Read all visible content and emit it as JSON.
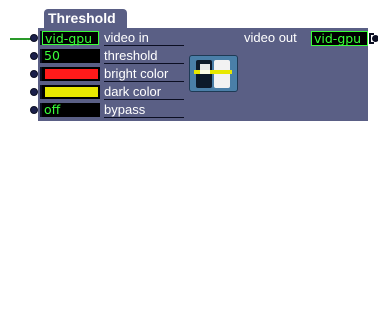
{
  "actor": {
    "title": "Threshold",
    "inputs": [
      {
        "value": "vid-gpu",
        "label": "video in",
        "kind": "video",
        "connected": true
      },
      {
        "value": "50",
        "label": "threshold",
        "kind": "number"
      },
      {
        "value": "",
        "label": "bright color",
        "kind": "color",
        "color": "#ff1a1a"
      },
      {
        "value": "",
        "label": "dark color",
        "kind": "color",
        "color": "#e8e800"
      },
      {
        "value": "off",
        "label": "bypass",
        "kind": "toggle"
      }
    ],
    "output": {
      "label": "video out",
      "value": "vid-gpu"
    },
    "colors": {
      "panel": "#5a5f85",
      "value_text": "#39ff39",
      "wire": "#2a9a2a",
      "thumbnail": "#4a7fa8"
    },
    "icon": "threshold-slider-icon"
  }
}
